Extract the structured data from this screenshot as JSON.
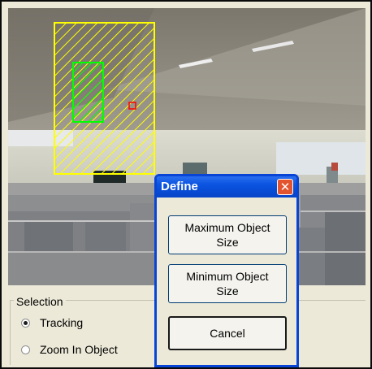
{
  "selection": {
    "legend": "Selection",
    "options": [
      {
        "label": "Tracking",
        "selected": true
      },
      {
        "label": "Zoom In Object",
        "selected": false
      }
    ]
  },
  "dialog": {
    "title": "Define",
    "close_glyph": "✕",
    "buttons": {
      "max_line1": "Maximum Object",
      "max_line2": "Size",
      "min_line1": "Minimum Object",
      "min_line2": "Size",
      "cancel": "Cancel"
    }
  },
  "overlay_colors": {
    "max_region": "#ffff00",
    "min_region": "#00ff00",
    "target_marker": "#ff0000"
  }
}
